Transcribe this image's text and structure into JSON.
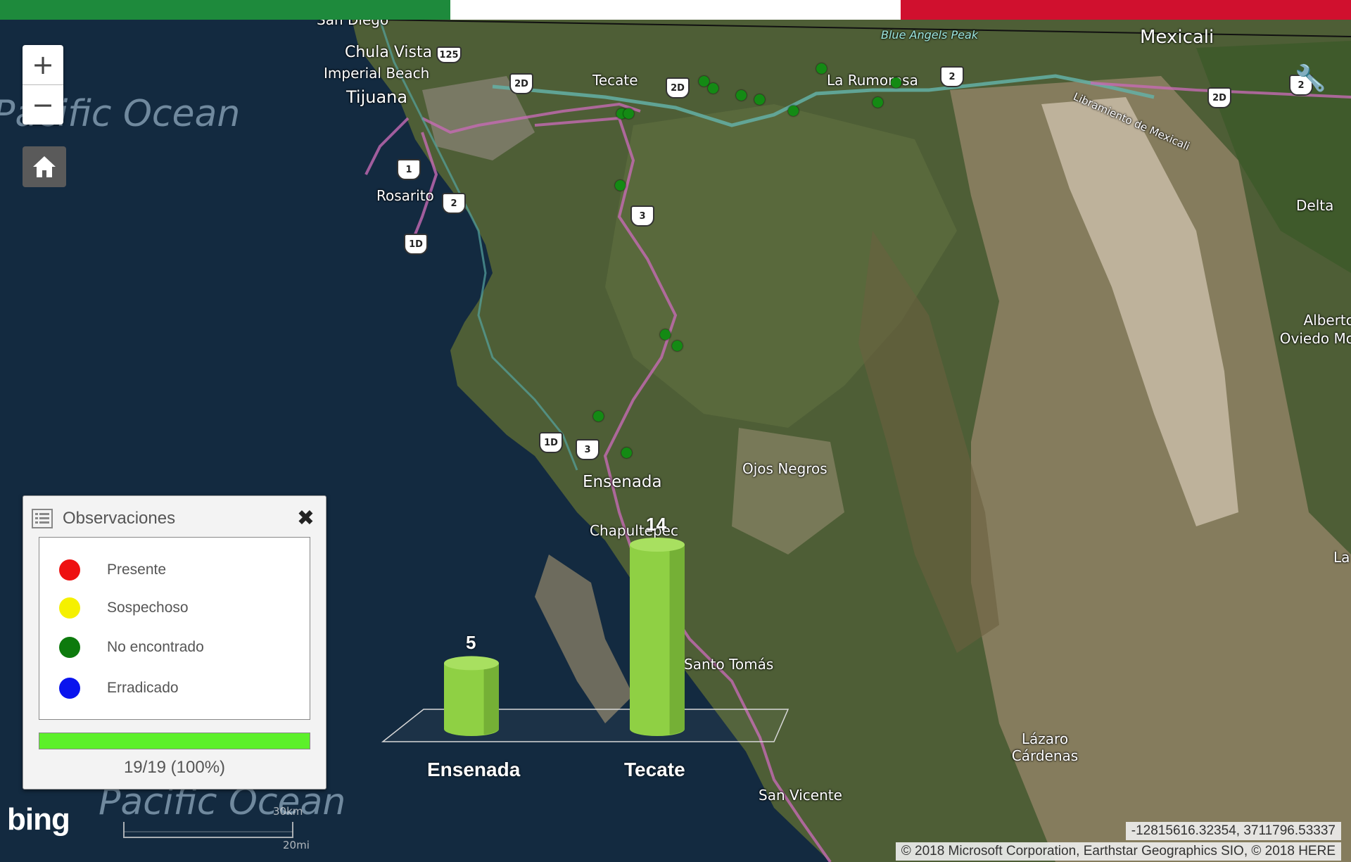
{
  "flag": {
    "colors": [
      "#1e8a3c",
      "#ffffff",
      "#d0102e"
    ]
  },
  "map": {
    "ocean_labels": [
      "Pacific Ocean",
      "Pacific Ocean"
    ],
    "places": [
      "San Diego",
      "Chula Vista",
      "Imperial Beach",
      "Tijuana",
      "Tecate",
      "La Rumorosa",
      "Mexicali",
      "Blue Angels Peak",
      "Rosarito",
      "Delta",
      "Alberto Oviedo Mo",
      "Ensenada",
      "Ojos Negros",
      "Chapultepec",
      "Santo Tomás",
      "Lázaro Cárdenas",
      "San Vicente",
      "La",
      "Libramiento de Mexicali"
    ],
    "shields": [
      "125",
      "2D",
      "2D",
      "2",
      "2D",
      "2",
      "1",
      "2",
      "1D",
      "3",
      "1D",
      "3"
    ],
    "observation_color": "#148a14",
    "observation_count": 19
  },
  "controls": {
    "zoom_in": "+",
    "zoom_out": "−",
    "home_icon": "home-icon",
    "tools_icon": "tools-icon"
  },
  "legend": {
    "title": "Observaciones",
    "close": "✖",
    "items": [
      {
        "label": "Presente",
        "color": "#ee1111"
      },
      {
        "label": "Sospechoso",
        "color": "#f5f000"
      },
      {
        "label": "No encontrado",
        "color": "#0d7a0d"
      },
      {
        "label": "Erradicado",
        "color": "#0a14ee"
      }
    ],
    "progress": 1.0,
    "progress_text": "19/19  (100%)"
  },
  "chart_data": {
    "type": "bar",
    "categories": [
      "Ensenada",
      "Tecate"
    ],
    "values": [
      5,
      14
    ],
    "title": "",
    "xlabel": "",
    "ylabel": "",
    "ylim": [
      0,
      14
    ],
    "bar_color": "#8fd044",
    "data_labels": true,
    "style": "3d-cylinder"
  },
  "footer": {
    "scale_km": "30km",
    "scale_mi": "20mi",
    "coordinates": "-12815616.32354, 3711796.53337",
    "copyright": "© 2018 Microsoft Corporation, Earthstar Geographics SIO, © 2018 HERE",
    "logo": "bing"
  }
}
